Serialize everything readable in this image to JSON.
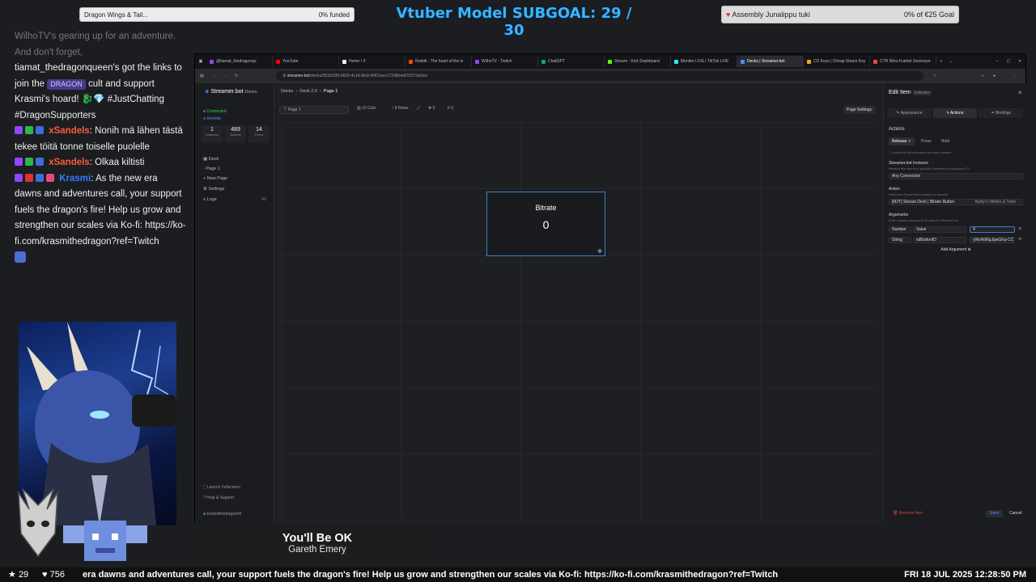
{
  "overlay": {
    "goal_left_label": "Dragon Wings & Tail...",
    "goal_left_value": "0% funded",
    "subgoal": "Vtuber Model SUBGOAL: 29 / 30",
    "goal_right_label": "Assembly Junalippu tuki",
    "goal_right_value": "0% of €25 Goal"
  },
  "chat": {
    "faded": "WilhoTV's gearing up for an adventure. And don't forget,",
    "m1_text": "tiamat_thedragonqueen's got the links to join the",
    "m1_pill": "DRAGON",
    "m1_tail": "cult and support Krasmi's hoard!",
    "m1_tags": "#JustChatting #DragonSupporters",
    "m2_user": "xSandels",
    "m2_text": ": Nonih mä lähen tästä tekee töitä tonne toiselle puolelle",
    "m3_user": "xSandels",
    "m3_text": ": Olkaa kiltisti",
    "m4_user": "Krasmi",
    "m4_text": ": As the new era dawns and adventures call, your support fuels the dragon's fire! Help us grow and strengthen our scales via Ko-fi: https://ko-fi.com/krasmithedragon?ref=Twitch"
  },
  "browser": {
    "tabs": [
      {
        "label": "@tiamat_thedragonqu",
        "color": "#9146ff"
      },
      {
        "label": "YouTube",
        "color": "#ff0000"
      },
      {
        "label": "Home / X",
        "color": "#ffffff"
      },
      {
        "label": "Reddit - The heart of the in",
        "color": "#ff4500"
      },
      {
        "label": "WilhoTV - Twitch",
        "color": "#9146ff"
      },
      {
        "label": "ChatGPT",
        "color": "#10a37f"
      },
      {
        "label": "Stream - Kick Dashboard",
        "color": "#53fc18"
      },
      {
        "label": "Monitor LIVE | TikTok LIVE",
        "color": "#25f4ee"
      },
      {
        "label": "Decks | Streamer.bot",
        "color": "#4a90ff"
      },
      {
        "label": "CD Keys | Cheap Steam Key",
        "color": "#f5a623"
      },
      {
        "label": "CTR Nitro-Fueled Journeyer",
        "color": "#e74c3c"
      }
    ],
    "url_host": "streamer.bot",
    "url_path": "/decks/353c02f9-b625-4c1d-9bcb-8451aec172d8/edit/1f1f7/action"
  },
  "sidebar": {
    "brand": "Streamer.bot",
    "brand_tag": "Decks",
    "connected": "Connected",
    "remote": "Remote",
    "stats": [
      {
        "n": "1",
        "l": "Instances"
      },
      {
        "n": "489",
        "l": "Actions"
      },
      {
        "n": "14",
        "l": "Peers"
      }
    ],
    "nav": [
      "Deck",
      "Page 1",
      "New Page",
      "Settings",
      "Logs"
    ],
    "logs_count": "40",
    "launch": "Launch Fullscreen",
    "help": "Help & Support",
    "user": "krasmithedragon#0"
  },
  "main": {
    "crumb1": "Decks",
    "crumb2": "Deck 2.0",
    "crumb3": "Page 1",
    "page_input": "Page 1",
    "cols": "10",
    "cols_label": "Cols",
    "rows": "8",
    "rows_label": "Rows",
    "offset_x": "0",
    "offset_y": "0",
    "page_settings": "Page Settings",
    "tile_title": "Bitrate",
    "tile_value": "0"
  },
  "panel": {
    "title": "Edit Item",
    "title_tag": "Indicator",
    "tabs": [
      "Appearance",
      "Actions",
      "Bindings"
    ],
    "actions_h": "Actions",
    "subtabs": [
      "Release",
      "Press",
      "Hold"
    ],
    "release_note": "Action will be executed on button release",
    "instance_label": "Streamer.bot Instance",
    "instance_sub": "Restrict this item to a specific Streamer.bot Instance ID?",
    "instance_value": "Any Connection",
    "action_label": "Action",
    "action_sub": "Select the Streamer.bot action to execute",
    "action_value": "[MJT] Stream Deck | Bitrate Button",
    "action_group": "Nutty's Utilities & Tools",
    "args_label": "Arguments",
    "args_sub": "Enter custom arguments to pass to Streamer.bot",
    "arg1_type": "Number",
    "arg1_name": "Value",
    "arg1_value": "4",
    "arg2_type": "String",
    "arg2_name": "sdButtonID",
    "arg2_value": "yWyRdRgJgwGKp-CC",
    "add_arg": "Add Argument",
    "remove": "Remove Item",
    "save": "Save",
    "cancel": "Cancel"
  },
  "song": {
    "title": "You'll Be OK",
    "artist": "Gareth Emery"
  },
  "ticker": {
    "stars": "29",
    "hearts": "756",
    "scroll": "era dawns and adventures call, your support fuels the dragon's fire! Help us grow and strengthen our scales via Ko-fi: https://ko-fi.com/krasmithedragon?ref=Twitch",
    "clock": "FRI 18 JUL 2025 12:28:50 PM"
  }
}
